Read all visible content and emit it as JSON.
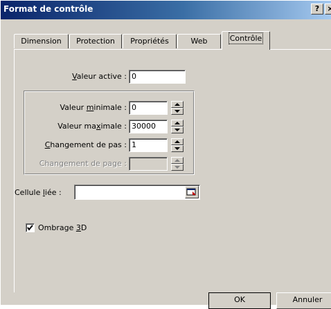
{
  "window": {
    "title": "Format de contrôle",
    "help_label": "?",
    "close_label": "×"
  },
  "tabs": [
    {
      "label": "Dimension",
      "active": false
    },
    {
      "label": "Protection",
      "active": false
    },
    {
      "label": "Propriétés",
      "active": false
    },
    {
      "label": "Web",
      "active": false
    },
    {
      "label": "Contrôle",
      "active": true
    }
  ],
  "controls": {
    "current_value": {
      "label_pre": "",
      "label_ul": "V",
      "label_post": "aleur active :",
      "value": "0"
    },
    "minimum": {
      "label_pre": "Valeur ",
      "label_ul": "m",
      "label_post": "inimale :",
      "value": "0"
    },
    "maximum": {
      "label_pre": "Valeur ma",
      "label_ul": "x",
      "label_post": "imale :",
      "value": "30000"
    },
    "increment": {
      "label_pre": "",
      "label_ul": "C",
      "label_post": "hangement de pas :",
      "value": "1"
    },
    "page_change": {
      "label": "Changement de page :",
      "value": "",
      "disabled": true
    },
    "cell_link": {
      "label_pre": "Cellule ",
      "label_ul": "l",
      "label_post": "iée :",
      "value": ""
    },
    "shading_3d": {
      "label_pre": "Ombrage ",
      "label_ul": "3",
      "label_post": "D",
      "checked": true
    }
  },
  "buttons": {
    "ok": "OK",
    "cancel": "Annuler"
  },
  "colors": {
    "title_gradient_start": "#0a246a",
    "title_gradient_end": "#a6caf0",
    "dialog_face": "#d4d0c8"
  }
}
